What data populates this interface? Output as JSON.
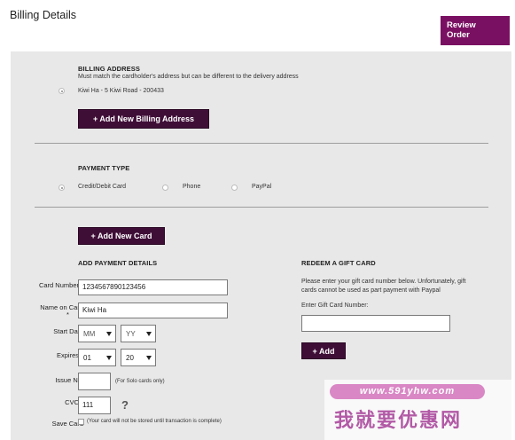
{
  "page": {
    "title": "Billing Details",
    "review_order": "Review\nOrder"
  },
  "billing": {
    "heading": "BILLING ADDRESS",
    "note": "Must match the cardholder's address but can be different to the delivery address",
    "address": "Kiwi Ha - 5 Kiwi Road - 200433",
    "add_button": "+ Add New Billing Address"
  },
  "payment_type": {
    "heading": "PAYMENT TYPE",
    "options": [
      "Credit/Debit Card",
      "Phone",
      "PayPal"
    ],
    "selected": "Credit/Debit Card",
    "add_card_button": "+ Add New Card"
  },
  "payment_details": {
    "heading": "ADD PAYMENT DETAILS",
    "card_number_label": "Card Number *",
    "card_number_value": "1234567890123456",
    "name_label_line1": "Name on Card",
    "name_label_line2": "*",
    "name_value": "Kiwi Ha",
    "start_date_label": "Start Date",
    "start_month": "MM",
    "start_year": "YY",
    "expires_label": "Expires *",
    "expires_month": "01",
    "expires_year": "20",
    "issue_label": "Issue No.",
    "issue_note": "(For Solo cards only)",
    "cvc_label": "CVC *",
    "cvc_value": "111",
    "cvc_help": "?",
    "save_label": "Save Card",
    "save_note": "(Your card will not be stored until transaction is complete)"
  },
  "gift_card": {
    "heading": "REDEEM A GIFT CARD",
    "text_line1": "Please enter your gift card number below. Unfortunately, gift",
    "text_line2": "cards cannot be used as part payment with Paypal",
    "field_label": "Enter Gift Card Number:",
    "field_value": "",
    "add_button": "+ Add"
  },
  "watermark": {
    "url": "www.591yhw.com",
    "text": "我就要优惠网"
  }
}
